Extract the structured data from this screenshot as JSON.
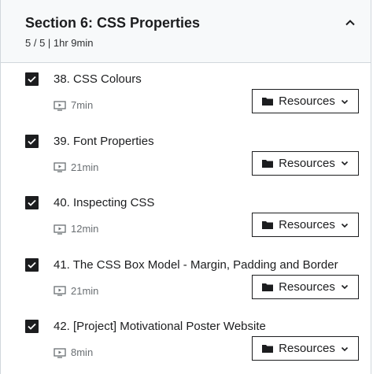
{
  "section": {
    "title": "Section 6: CSS Properties",
    "meta": "5 / 5 | 1hr 9min"
  },
  "lectures": [
    {
      "title": "38. CSS Colours",
      "duration": "7min",
      "resources_label": "Resources",
      "completed": true
    },
    {
      "title": "39. Font Properties",
      "duration": "21min",
      "resources_label": "Resources",
      "completed": true
    },
    {
      "title": "40. Inspecting CSS",
      "duration": "12min",
      "resources_label": "Resources",
      "completed": true
    },
    {
      "title": "41. The CSS Box Model - Margin, Padding and Border",
      "duration": "21min",
      "resources_label": "Resources",
      "completed": true
    },
    {
      "title": "42. [Project] Motivational Poster Website",
      "duration": "8min",
      "resources_label": "Resources",
      "completed": true
    }
  ],
  "icons": {
    "collapse": "chevron-up-icon",
    "checkbox": "check-icon",
    "video": "video-play-icon",
    "folder": "folder-icon",
    "dropdown": "chevron-down-icon"
  },
  "colors": {
    "text": "#1c1d1f",
    "muted": "#6a6f73",
    "header_bg": "#f7f9fa",
    "border": "#d1d7dc"
  }
}
